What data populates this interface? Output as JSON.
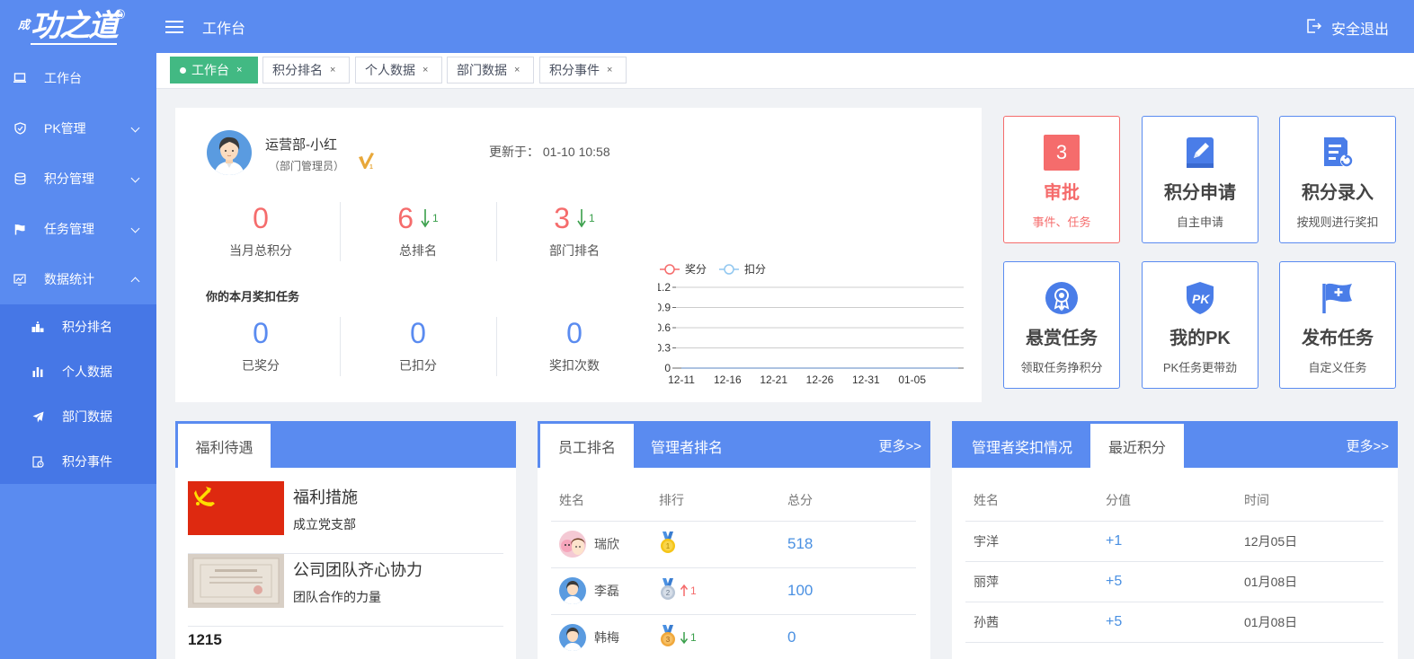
{
  "app": {
    "logo_small": "成",
    "logo_main": "功之道",
    "logo_reg": "®"
  },
  "sidebar": {
    "items": [
      {
        "label": "工作台",
        "icon": "monitor-icon"
      },
      {
        "label": "PK管理",
        "icon": "shield-icon"
      },
      {
        "label": "积分管理",
        "icon": "database-icon"
      },
      {
        "label": "任务管理",
        "icon": "flag-icon"
      },
      {
        "label": "数据统计",
        "icon": "chart-icon"
      }
    ],
    "subitems": [
      {
        "label": "积分排名",
        "icon": "podium-icon"
      },
      {
        "label": "个人数据",
        "icon": "bar-chart-icon"
      },
      {
        "label": "部门数据",
        "icon": "send-icon"
      },
      {
        "label": "积分事件",
        "icon": "event-icon"
      }
    ]
  },
  "header": {
    "title": "工作台",
    "logout": "安全退出"
  },
  "tabs": [
    {
      "label": "工作台",
      "active": true
    },
    {
      "label": "积分排名"
    },
    {
      "label": "个人数据"
    },
    {
      "label": "部门数据"
    },
    {
      "label": "积分事件"
    }
  ],
  "tab_close": "×",
  "profile": {
    "name": "运营部-小红",
    "role": "（部门管理员）",
    "updated_label": "更新于：",
    "updated_time": "01-10 10:58",
    "stats": [
      {
        "value": "0",
        "label": "当月总积分"
      },
      {
        "value": "6",
        "label": "总排名",
        "delta": "1"
      },
      {
        "value": "3",
        "label": "部门排名",
        "delta": "1"
      }
    ],
    "task_title": "你的本月奖扣任务",
    "task_stats": [
      {
        "value": "0",
        "label": "已奖分"
      },
      {
        "value": "0",
        "label": "已扣分"
      },
      {
        "value": "0",
        "label": "奖扣次数"
      }
    ]
  },
  "chart_data": {
    "type": "line",
    "x": [
      "12-11",
      "12-12",
      "12-13",
      "12-14",
      "12-15",
      "12-16",
      "12-17",
      "12-18",
      "12-19",
      "12-20",
      "12-21",
      "12-22",
      "12-23",
      "12-24",
      "12-25",
      "12-26",
      "12-27",
      "12-28",
      "12-29",
      "12-30",
      "12-31",
      "01-01",
      "01-02",
      "01-03",
      "01-04",
      "01-05",
      "01-06",
      "01-07",
      "01-08",
      "01-09",
      "01-10"
    ],
    "xticks": [
      "12-11",
      "12-16",
      "12-21",
      "12-26",
      "12-31",
      "01-05"
    ],
    "yticks": [
      "0",
      "0.3",
      "0.6",
      "0.9",
      "1.2"
    ],
    "ylim": [
      0,
      1.2
    ],
    "series": [
      {
        "name": "奖分",
        "color": "#f56c6c",
        "values": [
          0,
          0,
          0,
          0,
          0,
          0,
          0,
          0,
          0,
          0,
          0,
          0,
          0,
          0,
          0,
          0,
          0,
          0,
          0,
          0,
          0,
          0,
          0,
          0,
          0,
          0,
          0,
          0,
          0,
          0,
          0
        ]
      },
      {
        "name": "扣分",
        "color": "#91c7f0",
        "values": [
          0,
          0,
          0,
          0,
          0,
          0,
          0,
          0,
          0,
          0,
          0,
          0,
          0,
          0,
          0,
          0,
          0,
          0,
          0,
          0,
          0,
          0,
          0,
          0,
          0,
          0,
          0,
          0,
          0,
          0,
          0
        ]
      }
    ],
    "legend": "top-left",
    "grid": true
  },
  "tiles": [
    {
      "title": "审批",
      "sub": "事件、任务",
      "badge": "3",
      "icon": "approval-badge"
    },
    {
      "title": "积分申请",
      "sub": "自主申请",
      "icon": "edit-book-icon"
    },
    {
      "title": "积分录入",
      "sub": "按规则进行奖扣",
      "icon": "entry-list-icon"
    },
    {
      "title": "悬赏任务",
      "sub": "领取任务挣积分",
      "icon": "award-icon"
    },
    {
      "title": "我的PK",
      "sub": "PK任务更带劲",
      "icon": "pk-shield-icon"
    },
    {
      "title": "发布任务",
      "sub": "自定义任务",
      "icon": "flag-plus-icon"
    }
  ],
  "welfare": {
    "tab": "福利待遇",
    "items": [
      {
        "title": "福利措施",
        "sub": "成立党支部"
      },
      {
        "title": "公司团队齐心协力",
        "sub": "团队合作的力量"
      }
    ],
    "count": "1215"
  },
  "ranking": {
    "tabs": [
      "员工排名",
      "管理者排名"
    ],
    "more": "更多>>",
    "headers": [
      "姓名",
      "排行",
      "总分"
    ],
    "rows": [
      {
        "name": "瑞欣",
        "medal": "gold",
        "change": "",
        "score": "518"
      },
      {
        "name": "李磊",
        "medal": "silver",
        "change": "1",
        "dir": "up",
        "score": "100"
      },
      {
        "name": "韩梅",
        "medal": "bronze",
        "change": "1",
        "dir": "down",
        "score": "0"
      }
    ]
  },
  "recent": {
    "tabs": [
      "管理者奖扣情况",
      "最近积分"
    ],
    "more": "更多>>",
    "headers": [
      "姓名",
      "分值",
      "时间"
    ],
    "rows": [
      {
        "name": "宇洋",
        "value": "+1",
        "time": "12月05日"
      },
      {
        "name": "丽萍",
        "value": "+5",
        "time": "01月08日"
      },
      {
        "name": "孙茜",
        "value": "+5",
        "time": "01月08日"
      },
      {
        "name": "",
        "value": "",
        "time": ""
      }
    ]
  }
}
